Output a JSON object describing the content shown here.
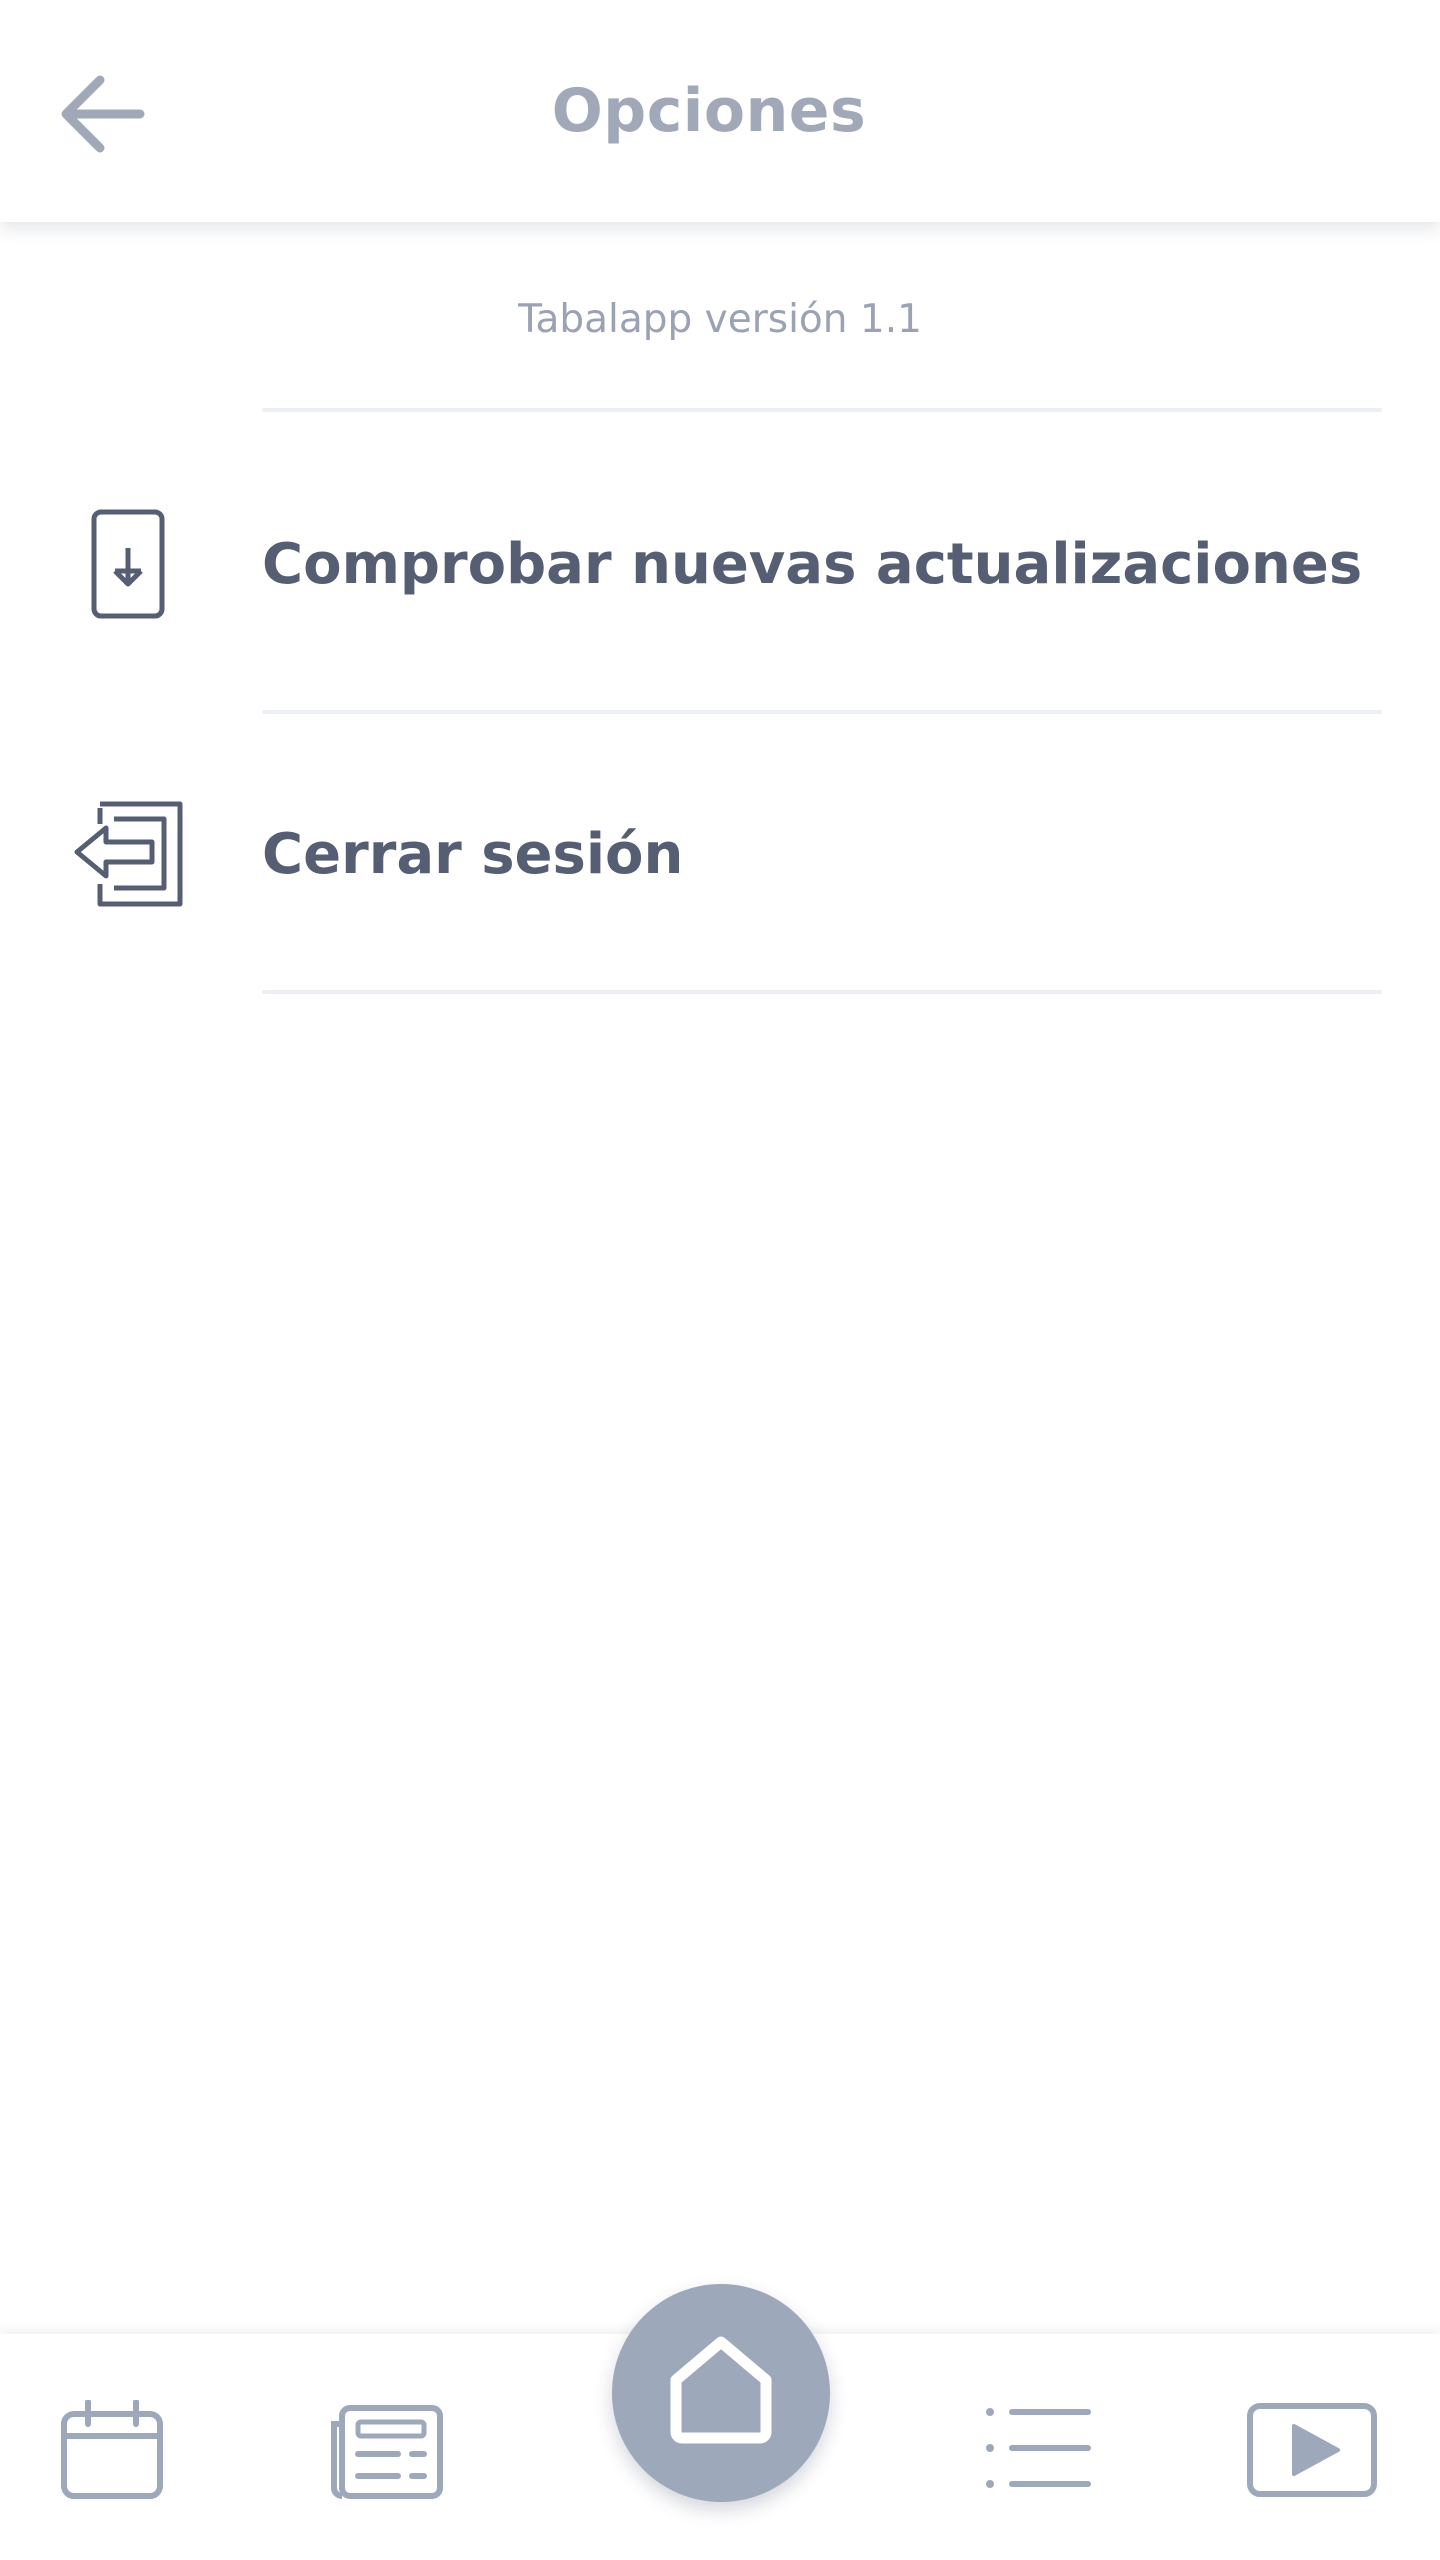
{
  "header": {
    "title": "Opciones",
    "back_icon": "arrow-left-icon"
  },
  "version": {
    "text": "Tabalapp versión 1.1"
  },
  "menu": {
    "items": [
      {
        "label": "Comprobar nuevas actualizaciones",
        "icon": "download-update-icon"
      },
      {
        "label": "Cerrar sesión",
        "icon": "logout-icon"
      }
    ]
  },
  "bottom_nav": {
    "items": [
      {
        "icon": "calendar-icon"
      },
      {
        "icon": "news-icon"
      },
      {
        "icon": "home-icon",
        "selected": true
      },
      {
        "icon": "list-icon"
      },
      {
        "icon": "video-icon"
      }
    ]
  },
  "colors": {
    "title": "#a1a9b9",
    "text_dark": "#555e72",
    "icon_muted": "#9ea8bb",
    "fab_background": "#9ea8bb",
    "divider": "#eceff5"
  }
}
